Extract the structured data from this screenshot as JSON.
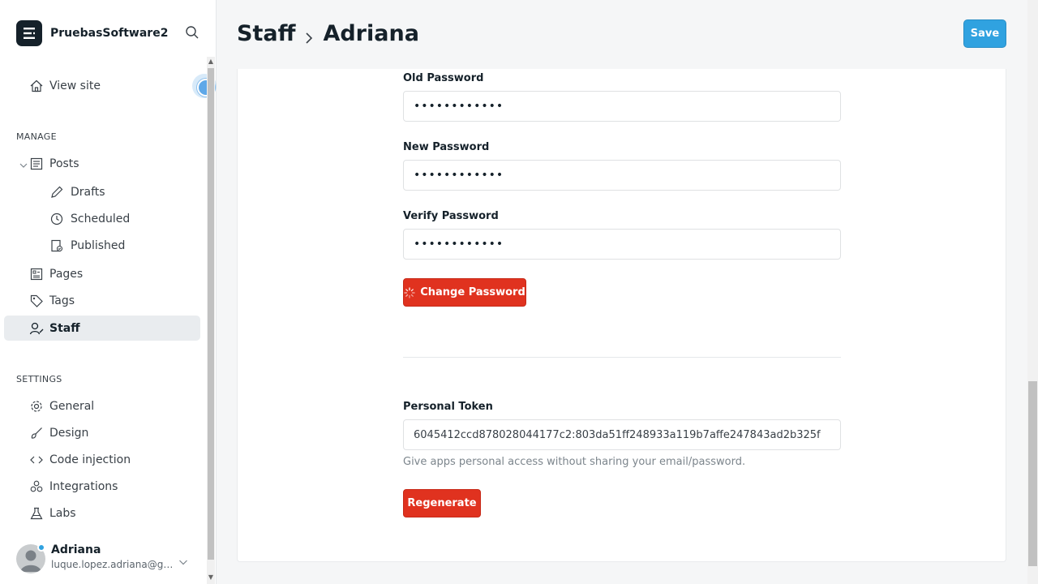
{
  "brand": {
    "name": "PruebasSoftware2"
  },
  "nav": {
    "view_site": "View site",
    "manage_label": "MANAGE",
    "posts": "Posts",
    "drafts": "Drafts",
    "scheduled": "Scheduled",
    "published": "Published",
    "pages": "Pages",
    "tags": "Tags",
    "staff": "Staff",
    "settings_label": "SETTINGS",
    "general": "General",
    "design": "Design",
    "code_injection": "Code injection",
    "integrations": "Integrations",
    "labs": "Labs"
  },
  "user": {
    "name": "Adriana",
    "email": "luque.lopez.adriana@gmail.com"
  },
  "header": {
    "crumb_parent": "Staff",
    "crumb_current": "Adriana",
    "save_label": "Save"
  },
  "form": {
    "old_password_label": "Old Password",
    "old_password_value": "••••••••••••",
    "new_password_label": "New Password",
    "new_password_value": "••••••••••••",
    "verify_password_label": "Verify Password",
    "verify_password_value": "••••••••••••",
    "change_password_label": "Change Password",
    "token_label": "Personal Token",
    "token_value": "6045412ccd878028044177c2:803da51ff248933a119b7affe247843ad2b325f",
    "token_help": "Give apps personal access without sharing your email/password.",
    "regenerate_label": "Regenerate"
  },
  "colors": {
    "accent": "#30a2e0",
    "danger": "#e0321f",
    "active_bg": "#e9ecef"
  }
}
